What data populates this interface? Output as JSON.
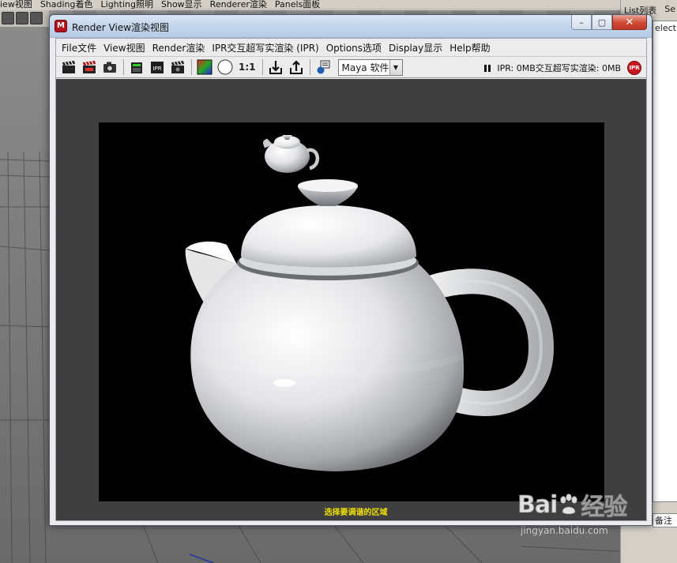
{
  "background": {
    "menu": [
      "iew视图",
      "Shading着色",
      "Lighting照明",
      "Show显示",
      "Renderer渲染",
      "Panels面板"
    ],
    "right_panel_menu": [
      "List列表",
      "Se"
    ],
    "right_panel_list_text": "electio",
    "right_panel_note": "备注"
  },
  "window": {
    "title": "Render View渲染视图",
    "app_icon_letter": "M",
    "controls": {
      "minimize": "–",
      "maximize": "▢",
      "close": "✕"
    }
  },
  "menubar": {
    "items": [
      "File文件",
      "View视图",
      "Render渲染",
      "IPR交互超写实渲染 (IPR)",
      "Options选项",
      "Display显示",
      "Help帮助"
    ]
  },
  "toolbar": {
    "ratio_label": "1:1",
    "renderer_value": "Maya 软件",
    "ipr_status": "IPR: 0MB交互超写实渲染: 0MB",
    "ipr_badge": "IPR",
    "icons": [
      "render-region-icon",
      "redo-render-icon",
      "snapshot-icon",
      "render-sequence-icon",
      "ipr-render-icon",
      "refresh-ipr-icon",
      "color-channels-icon",
      "alpha-channel-icon",
      "keep-image-icon",
      "remove-image-icon",
      "render-settings-icon"
    ]
  },
  "render": {
    "status_message": "选择要调谐的区域"
  },
  "watermark": {
    "brand": "Bai",
    "brand_suffix": "经验",
    "url": "jingyan.baidu.com"
  },
  "colors": {
    "render_background": "#3f3f3f",
    "image_background": "#000000",
    "status_text": "#f0e000",
    "accent_red": "#c8171f"
  }
}
